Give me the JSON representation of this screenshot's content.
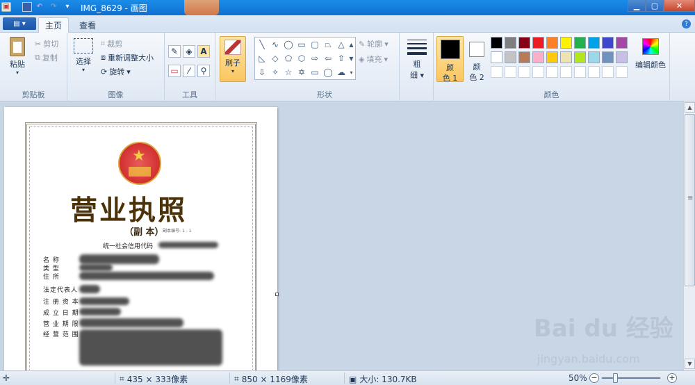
{
  "titlebar": {
    "title": "IMG_8629 - 画图",
    "qa_dropdown": "▾"
  },
  "tabs": [
    {
      "label": "主页"
    },
    {
      "label": "查看"
    }
  ],
  "help": "?",
  "clipboard": {
    "paste": "粘贴",
    "cut": "剪切",
    "copy": "复制",
    "group": "剪贴板"
  },
  "image": {
    "select": "选择",
    "crop": "裁剪",
    "resize": "重新调整大小",
    "rotate": "旋转",
    "group": "图像"
  },
  "tools": {
    "group": "工具"
  },
  "brushes": {
    "label": "刷子"
  },
  "shapes": {
    "outline": "轮廓",
    "fill": "填充",
    "group": "形状"
  },
  "size": {
    "line1": "粗",
    "line2": "细"
  },
  "colors": {
    "color1_a": "颜",
    "color1_b": "色 1",
    "color2_a": "颜",
    "color2_b": "色 2",
    "edit": "编辑颜色",
    "group": "颜色",
    "color1_value": "#000000",
    "color2_value": "#ffffff",
    "palette_row1": [
      "#000000",
      "#7f7f7f",
      "#880015",
      "#ed1c24",
      "#ff7f27",
      "#fff200",
      "#22b14c",
      "#00a2e8",
      "#3f48cc",
      "#a349a4"
    ],
    "palette_row2": [
      "#ffffff",
      "#c3c3c3",
      "#b97a57",
      "#ffaec9",
      "#ffc90e",
      "#efe4b0",
      "#b5e61d",
      "#99d9ea",
      "#7092be",
      "#c8bfe7"
    ],
    "palette_row3": [
      "#ffffff",
      "#ffffff",
      "#ffffff",
      "#ffffff",
      "#ffffff",
      "#ffffff",
      "#ffffff",
      "#ffffff",
      "#ffffff",
      "#ffffff"
    ]
  },
  "document": {
    "title": "营业执照",
    "copy": "（副 本）",
    "serial": "副本编号: 1 - 1",
    "code_label": "统一社会信用代码",
    "fields": [
      {
        "label": "名          称"
      },
      {
        "label": "类          型"
      },
      {
        "label": "住          所"
      },
      {
        "label": "法定代表人"
      },
      {
        "label": "注 册 资 本"
      },
      {
        "label": "成 立 日 期"
      },
      {
        "label": "营 业 期 限"
      },
      {
        "label": "经 营 范 围"
      }
    ]
  },
  "watermark": {
    "logo": "Bai du 经验",
    "url": "jingyan.baidu.com"
  },
  "status": {
    "cursor": "435 × 333像素",
    "size": "850 × 1169像素",
    "filesize": "大小: 130.7KB",
    "zoom": "50%",
    "zoom_level": 0.5
  }
}
